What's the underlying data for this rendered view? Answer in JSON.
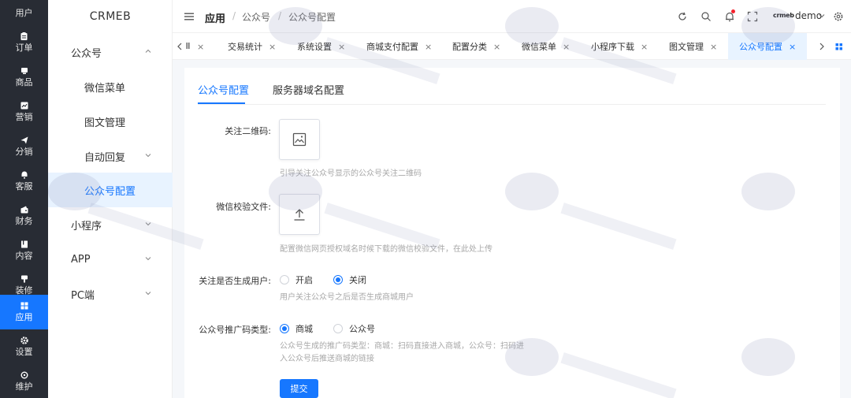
{
  "rail": {
    "items": [
      {
        "label": "用户",
        "icon": "user-icon"
      },
      {
        "label": "订单",
        "icon": "order-icon"
      },
      {
        "label": "商品",
        "icon": "product-icon"
      },
      {
        "label": "营销",
        "icon": "marketing-icon"
      },
      {
        "label": "分销",
        "icon": "distribution-icon"
      },
      {
        "label": "客服",
        "icon": "service-icon"
      },
      {
        "label": "财务",
        "icon": "finance-icon"
      },
      {
        "label": "内容",
        "icon": "content-icon"
      },
      {
        "label": "装修",
        "icon": "decoration-icon"
      },
      {
        "label": "应用",
        "icon": "apps-icon",
        "active": true
      },
      {
        "label": "设置",
        "icon": "settings-icon"
      },
      {
        "label": "维护",
        "icon": "maintenance-icon"
      }
    ]
  },
  "submenu": {
    "brand": "CRMEB",
    "items": [
      {
        "label": "公众号",
        "expanded": true
      },
      {
        "label": "微信菜单",
        "child": true
      },
      {
        "label": "图文管理",
        "child": true
      },
      {
        "label": "自动回复",
        "child": true,
        "expandable": true
      },
      {
        "label": "公众号配置",
        "child": true,
        "active": true
      },
      {
        "label": "小程序",
        "expandable": true
      },
      {
        "label": "APP",
        "expandable": true
      },
      {
        "label": "PC端",
        "expandable": true
      }
    ]
  },
  "header": {
    "breadcrumb": [
      "应用",
      "公众号",
      "公众号配置"
    ],
    "separator": "/",
    "user_logo": "crmeb",
    "user_name": "demo"
  },
  "tabs": {
    "items": [
      {
        "label": "交易统计"
      },
      {
        "label": "系统设置"
      },
      {
        "label": "商城支付配置"
      },
      {
        "label": "配置分类"
      },
      {
        "label": "微信菜单"
      },
      {
        "label": "小程序下载"
      },
      {
        "label": "图文管理"
      },
      {
        "label": "公众号配置",
        "active": true
      }
    ],
    "close": "×"
  },
  "content": {
    "tabs": [
      "公众号配置",
      "服务器域名配置"
    ],
    "form": {
      "qrcode_label": "关注二维码:",
      "qrcode_help": "引导关注公众号显示的公众号关注二维码",
      "verify_label": "微信校验文件:",
      "verify_help": "配置微信网页授权域名时候下载的微信校验文件，在此处上传",
      "subscribe_label": "关注是否生成用户:",
      "subscribe_options": [
        "开启",
        "关闭"
      ],
      "subscribe_value": "关闭",
      "subscribe_help": "用户关注公众号之后是否生成商城用户",
      "promo_label": "公众号推广码类型:",
      "promo_options": [
        "商城",
        "公众号"
      ],
      "promo_value": "商城",
      "promo_help_1": "公众号生成的推广码类型：商城：扫码直接进入商城，公众号：扫码进",
      "promo_help_2": "入公众号后推送商城的链接",
      "submit_label": "提交"
    }
  },
  "colors": {
    "primary": "#1677ff",
    "rail_bg": "#282c34",
    "active_bg": "#e8f3ff"
  }
}
